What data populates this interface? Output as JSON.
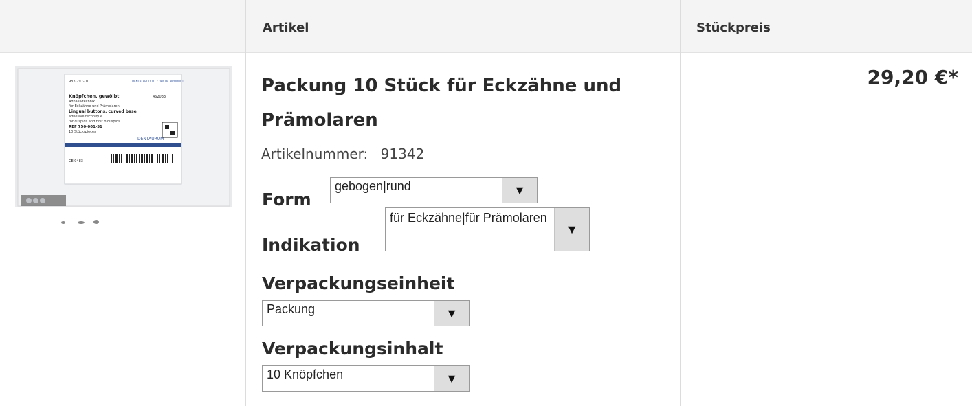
{
  "table": {
    "header_article": "Artikel",
    "header_price": "Stückpreis"
  },
  "product": {
    "title": "Packung 10 Stück für Eckzähne und Prämolaren",
    "article_number_label": "Artikelnummer:",
    "article_number": "91342",
    "price": "29,20 €*",
    "image": {
      "ref_line": "987-297-01",
      "brand_line": "DENTALPRODUKT / DENTAL PRODUCT",
      "name_de": "Knöpfchen, gewölbt",
      "sub_de": "Adhäsivtechnik",
      "sub_de2": "für Eckzähne und Prämolaren",
      "name_en": "Lingual buttons, curved base",
      "sub_en": "adhesive technique",
      "sub_en2": "for cuspids and first bicuspids",
      "ref": "REF 750-001-51",
      "count": "10 Stück/pieces",
      "lot": "462033",
      "maker": "DENTAURUM",
      "ce": "CE 0483"
    }
  },
  "options": {
    "form": {
      "label": "Form",
      "value": "gebogen|rund"
    },
    "indication": {
      "label": "Indikation",
      "value": "für Eckzähne|für Prämolaren"
    },
    "unit": {
      "label": "Verpackungseinheit",
      "value": "Packung"
    },
    "content": {
      "label": "Verpackungsinhalt",
      "value": "10 Knöpfchen"
    }
  }
}
